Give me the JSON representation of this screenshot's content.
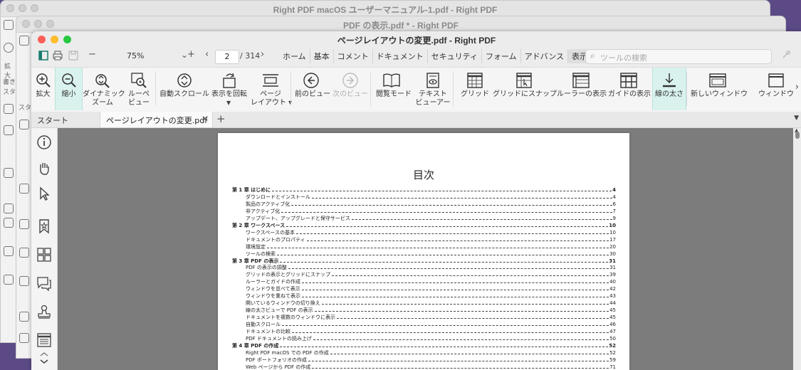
{
  "background_windows": [
    {
      "title": "Right PDF macOS ユーザーマニュアル-1.pdf - Right PDF",
      "labels": [
        "拡大",
        "書き",
        "スタ"
      ]
    },
    {
      "title": "PDF の表示.pdf * - Right PDF",
      "labels": [
        "スタ"
      ]
    }
  ],
  "window": {
    "title": "ページレイアウトの変更.pdf - Right PDF"
  },
  "toolbar": {
    "zoom_value": "75%",
    "page_current": "2",
    "page_total": "/ 314",
    "menu_tabs": [
      "ホーム",
      "基本",
      "コメント",
      "ドキュメント",
      "セキュリティ",
      "フォーム",
      "アドバンス",
      "表示"
    ],
    "active_tab": "表示",
    "search_placeholder": "ツールの検索"
  },
  "ribbon": {
    "items": [
      {
        "label": "拡大",
        "icon": "zoom-in-icon"
      },
      {
        "label": "縮小",
        "icon": "zoom-out-icon",
        "active": true
      },
      {
        "label": "ダイナミック",
        "label2": "ズーム",
        "icon": "dynamic-zoom-icon"
      },
      {
        "label": "ルーペ",
        "label2": "ビュー",
        "icon": "loupe-icon"
      },
      {
        "label": "自動スクロール",
        "icon": "auto-scroll-icon"
      },
      {
        "label": "表示を回転",
        "icon": "rotate-icon"
      },
      {
        "label": "ページ",
        "label2": "レイアウト ▾",
        "icon": "page-layout-icon"
      },
      {
        "label": "前のビュー",
        "icon": "previous-view-icon"
      },
      {
        "label": "次のビュー",
        "icon": "next-view-icon",
        "disabled": true
      },
      {
        "label": "閲覧モード",
        "icon": "reading-mode-icon"
      },
      {
        "label": "テキスト",
        "label2": "ビューアー",
        "icon": "text-viewer-icon"
      },
      {
        "label": "グリッド",
        "icon": "grid-icon"
      },
      {
        "label": "グリッドにスナップ",
        "icon": "snap-to-grid-icon"
      },
      {
        "label": "ルーラーの表示",
        "icon": "ruler-icon"
      },
      {
        "label": "ガイドの表示",
        "icon": "guide-icon"
      },
      {
        "label": "線の太さ",
        "icon": "line-weight-icon",
        "active": true
      },
      {
        "label": "新しいウィンドウ",
        "icon": "new-window-icon"
      },
      {
        "label": "ウィンドウ",
        "icon": "window-icon"
      }
    ]
  },
  "tabs": {
    "start": "スタート",
    "document": "ページレイアウトの変更.pdf"
  },
  "document": {
    "heading": "目次",
    "toc": [
      {
        "level": 1,
        "text": "第 1 章  はじめに",
        "page": "4"
      },
      {
        "level": 2,
        "text": "ダウンロードとインストール",
        "page": "4"
      },
      {
        "level": 2,
        "text": "製品のアクティブ化",
        "page": "6"
      },
      {
        "level": 2,
        "text": "非アクティブ化",
        "page": "7"
      },
      {
        "level": 2,
        "text": "アップデート、アップグレードと保守サービス",
        "page": "9"
      },
      {
        "level": 1,
        "text": "第 2 章  ワークスペース",
        "page": "10"
      },
      {
        "level": 2,
        "text": "ワークスペースの基本",
        "page": "10"
      },
      {
        "level": 2,
        "text": "ドキュメントのプロパティ",
        "page": "17"
      },
      {
        "level": 2,
        "text": "環境設定",
        "page": "20"
      },
      {
        "level": 2,
        "text": "ツールの検索",
        "page": "30"
      },
      {
        "level": 1,
        "text": "第 3 章  PDF の表示",
        "page": "31"
      },
      {
        "level": 2,
        "text": "PDF の表示の調整",
        "page": "31"
      },
      {
        "level": 2,
        "text": "グリッドの表示とグリッドにスナップ",
        "page": "39"
      },
      {
        "level": 2,
        "text": "ルーラーとガイドの作成",
        "page": "40"
      },
      {
        "level": 2,
        "text": "ウィンドウを並べて表示",
        "page": "42"
      },
      {
        "level": 2,
        "text": "ウィンドウを重ねて表示",
        "page": "43"
      },
      {
        "level": 2,
        "text": "開いているウィンドウの切り換え",
        "page": "44"
      },
      {
        "level": 2,
        "text": "線の太さビューで PDF の表示",
        "page": "45"
      },
      {
        "level": 2,
        "text": "ドキュメントを複数のウィンドウに表示",
        "page": "45"
      },
      {
        "level": 2,
        "text": "自動スクロール",
        "page": "46"
      },
      {
        "level": 2,
        "text": "ドキュメントの比較",
        "page": "47"
      },
      {
        "level": 2,
        "text": "PDF ドキュメントの読み上げ",
        "page": "50"
      },
      {
        "level": 1,
        "text": "第 4 章  PDF の作成",
        "page": "52"
      },
      {
        "level": 2,
        "text": "Right PDF macOS での PDF の作成",
        "page": "52"
      },
      {
        "level": 2,
        "text": "PDF ポートフォリオの作成",
        "page": "59"
      },
      {
        "level": 2,
        "text": "Web ページから PDF の作成",
        "page": "71"
      }
    ]
  }
}
